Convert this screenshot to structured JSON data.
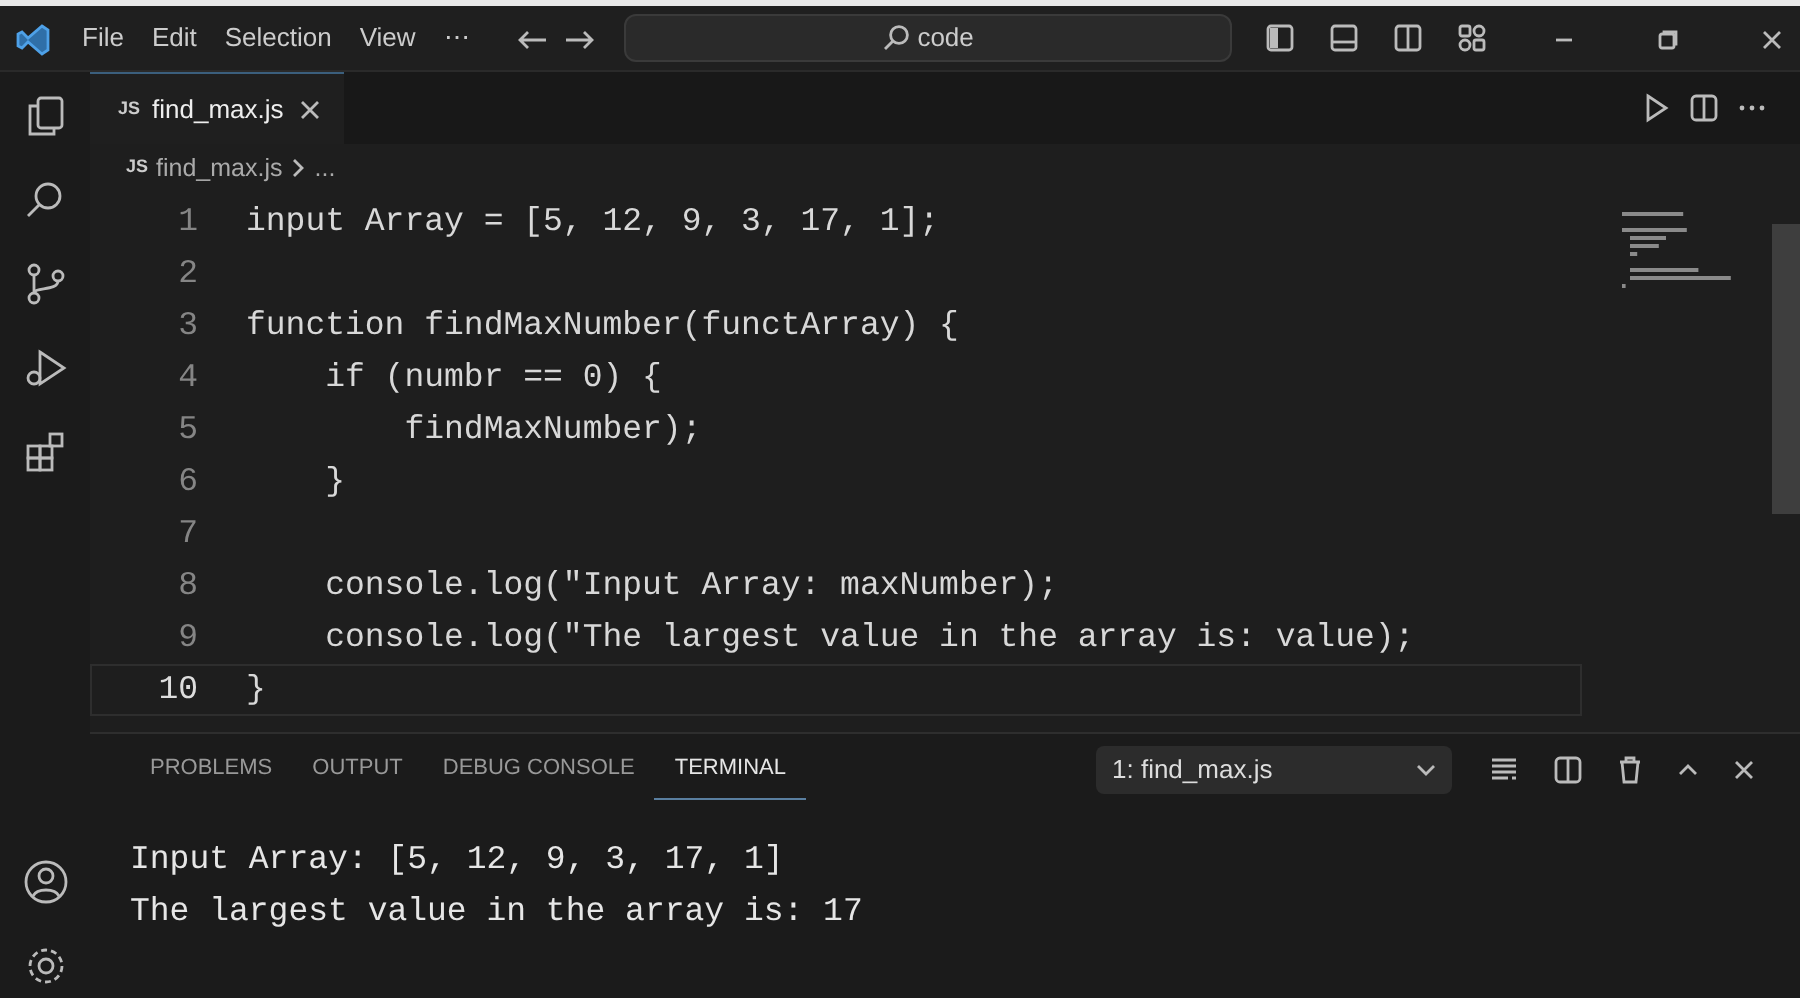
{
  "title_bar": {
    "menu": [
      "File",
      "Edit",
      "Selection",
      "View",
      "⋯"
    ],
    "search": "code"
  },
  "tabs": [
    {
      "badge": "JS",
      "label": "find_max.js",
      "selected": true
    }
  ],
  "breadcrumb": {
    "badge": "JS",
    "file": "find_max.js",
    "rest": "..."
  },
  "editor": {
    "lines": [
      {
        "number": "1",
        "text": "input Array = [5, 12, 9, 3, 17, 1];",
        "current": false
      },
      {
        "number": "2",
        "current": false
      },
      {
        "number": "3",
        "text": "function findMaxNumber(functArray) {",
        "current": false
      },
      {
        "number": "4",
        "text": "    if (numbr == 0) {",
        "current": false
      },
      {
        "number": "5",
        "text": "        findMaxNumber);",
        "current": false
      },
      {
        "number": "6",
        "text": "    }",
        "current": false
      },
      {
        "number": "7",
        "current": false
      },
      {
        "number": "8",
        "text": "    console.log(\"Input Array: maxNumber);",
        "current": false
      },
      {
        "number": "9",
        "text": "    console.log(\"The largest value in the array is: value);",
        "current": false
      },
      {
        "number": "10",
        "text": "}",
        "current": true
      }
    ]
  },
  "panel": {
    "tabs": [
      {
        "label": "PROBLEMS",
        "selected": false
      },
      {
        "label": "OUTPUT",
        "selected": false
      },
      {
        "label": "DEBUG CONSOLE",
        "selected": false
      },
      {
        "label": "TERMINAL",
        "selected": true
      }
    ],
    "terminal_select": "1: find_max.js",
    "terminal_lines": [
      "Input Array: [5, 12, 9, 3, 17, 1]",
      "The largest value in the array is: 17"
    ]
  }
}
